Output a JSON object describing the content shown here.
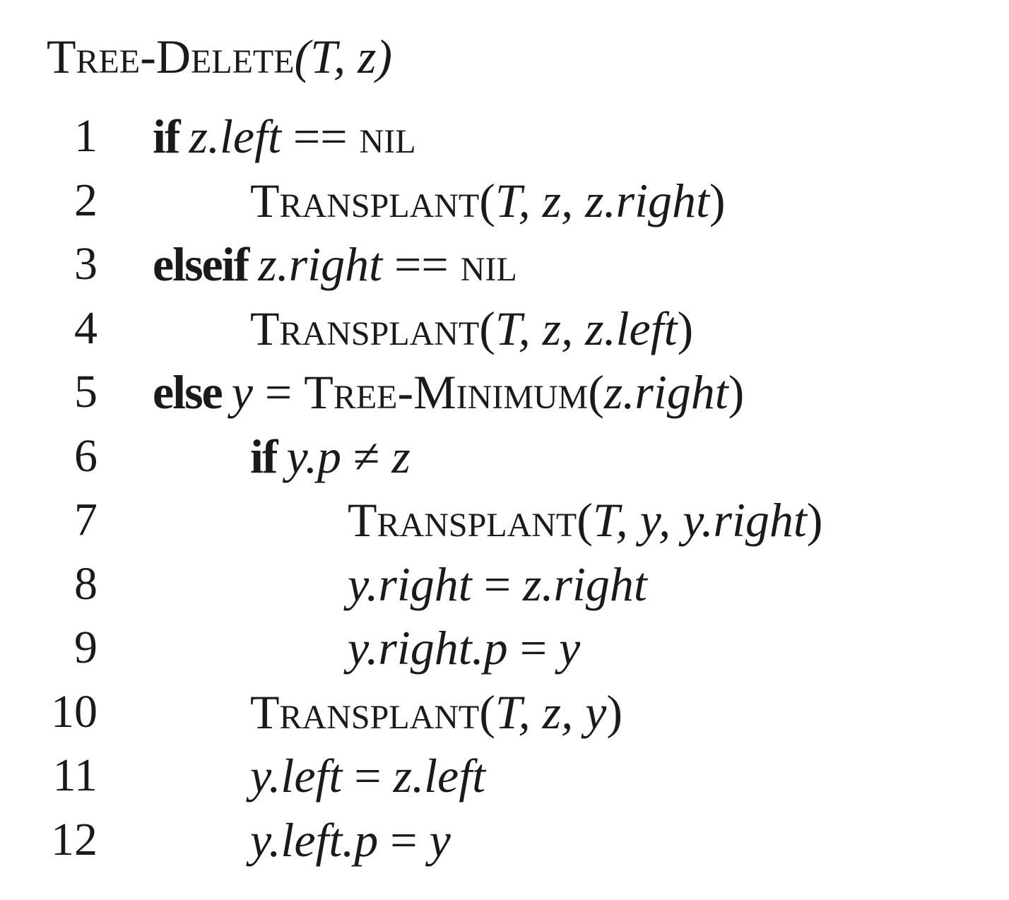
{
  "title": {
    "name": "Tree-Delete",
    "params": "(T, z)"
  },
  "lines": [
    {
      "num": "1",
      "indent": 0,
      "tokens": [
        {
          "t": "kw",
          "v": "if"
        },
        {
          "t": "sp"
        },
        {
          "t": "it",
          "v": "z.left"
        },
        {
          "t": "n",
          "v": " == "
        },
        {
          "t": "sc",
          "v": "nil"
        }
      ]
    },
    {
      "num": "2",
      "indent": 1,
      "tokens": [
        {
          "t": "sc",
          "v": "Transplant"
        },
        {
          "t": "n",
          "v": "("
        },
        {
          "t": "it",
          "v": "T, z, z.right"
        },
        {
          "t": "n",
          "v": ")"
        }
      ]
    },
    {
      "num": "3",
      "indent": 0,
      "tokens": [
        {
          "t": "kw",
          "v": "elseif"
        },
        {
          "t": "sp"
        },
        {
          "t": "it",
          "v": "z.right"
        },
        {
          "t": "n",
          "v": " == "
        },
        {
          "t": "sc",
          "v": "nil"
        }
      ]
    },
    {
      "num": "4",
      "indent": 1,
      "tokens": [
        {
          "t": "sc",
          "v": "Transplant"
        },
        {
          "t": "n",
          "v": "("
        },
        {
          "t": "it",
          "v": "T, z, z.left"
        },
        {
          "t": "n",
          "v": ")"
        }
      ]
    },
    {
      "num": "5",
      "indent": 0,
      "tokens": [
        {
          "t": "kw",
          "v": "else"
        },
        {
          "t": "sp"
        },
        {
          "t": "it",
          "v": "y"
        },
        {
          "t": "n",
          "v": " = "
        },
        {
          "t": "sc",
          "v": "Tree-Minimum"
        },
        {
          "t": "n",
          "v": "("
        },
        {
          "t": "it",
          "v": "z.right"
        },
        {
          "t": "n",
          "v": ")"
        }
      ]
    },
    {
      "num": "6",
      "indent": 1,
      "tokens": [
        {
          "t": "kw",
          "v": "if"
        },
        {
          "t": "sp"
        },
        {
          "t": "it",
          "v": "y.p"
        },
        {
          "t": "n",
          "v": " ≠ "
        },
        {
          "t": "it",
          "v": "z"
        }
      ]
    },
    {
      "num": "7",
      "indent": 2,
      "tokens": [
        {
          "t": "sc",
          "v": "Transplant"
        },
        {
          "t": "n",
          "v": "("
        },
        {
          "t": "it",
          "v": "T, y, y.right"
        },
        {
          "t": "n",
          "v": ")"
        }
      ]
    },
    {
      "num": "8",
      "indent": 2,
      "tokens": [
        {
          "t": "it",
          "v": "y.right"
        },
        {
          "t": "n",
          "v": " = "
        },
        {
          "t": "it",
          "v": "z.right"
        }
      ]
    },
    {
      "num": "9",
      "indent": 2,
      "tokens": [
        {
          "t": "it",
          "v": "y.right.p"
        },
        {
          "t": "n",
          "v": " = "
        },
        {
          "t": "it",
          "v": "y"
        }
      ]
    },
    {
      "num": "10",
      "indent": 1,
      "tokens": [
        {
          "t": "sc",
          "v": "Transplant"
        },
        {
          "t": "n",
          "v": "("
        },
        {
          "t": "it",
          "v": "T, z, y"
        },
        {
          "t": "n",
          "v": ")"
        }
      ]
    },
    {
      "num": "11",
      "indent": 1,
      "tokens": [
        {
          "t": "it",
          "v": "y.left"
        },
        {
          "t": "n",
          "v": " = "
        },
        {
          "t": "it",
          "v": "z.left"
        }
      ]
    },
    {
      "num": "12",
      "indent": 1,
      "tokens": [
        {
          "t": "it",
          "v": "y.left.p"
        },
        {
          "t": "n",
          "v": " = "
        },
        {
          "t": "it",
          "v": "y"
        }
      ]
    }
  ]
}
